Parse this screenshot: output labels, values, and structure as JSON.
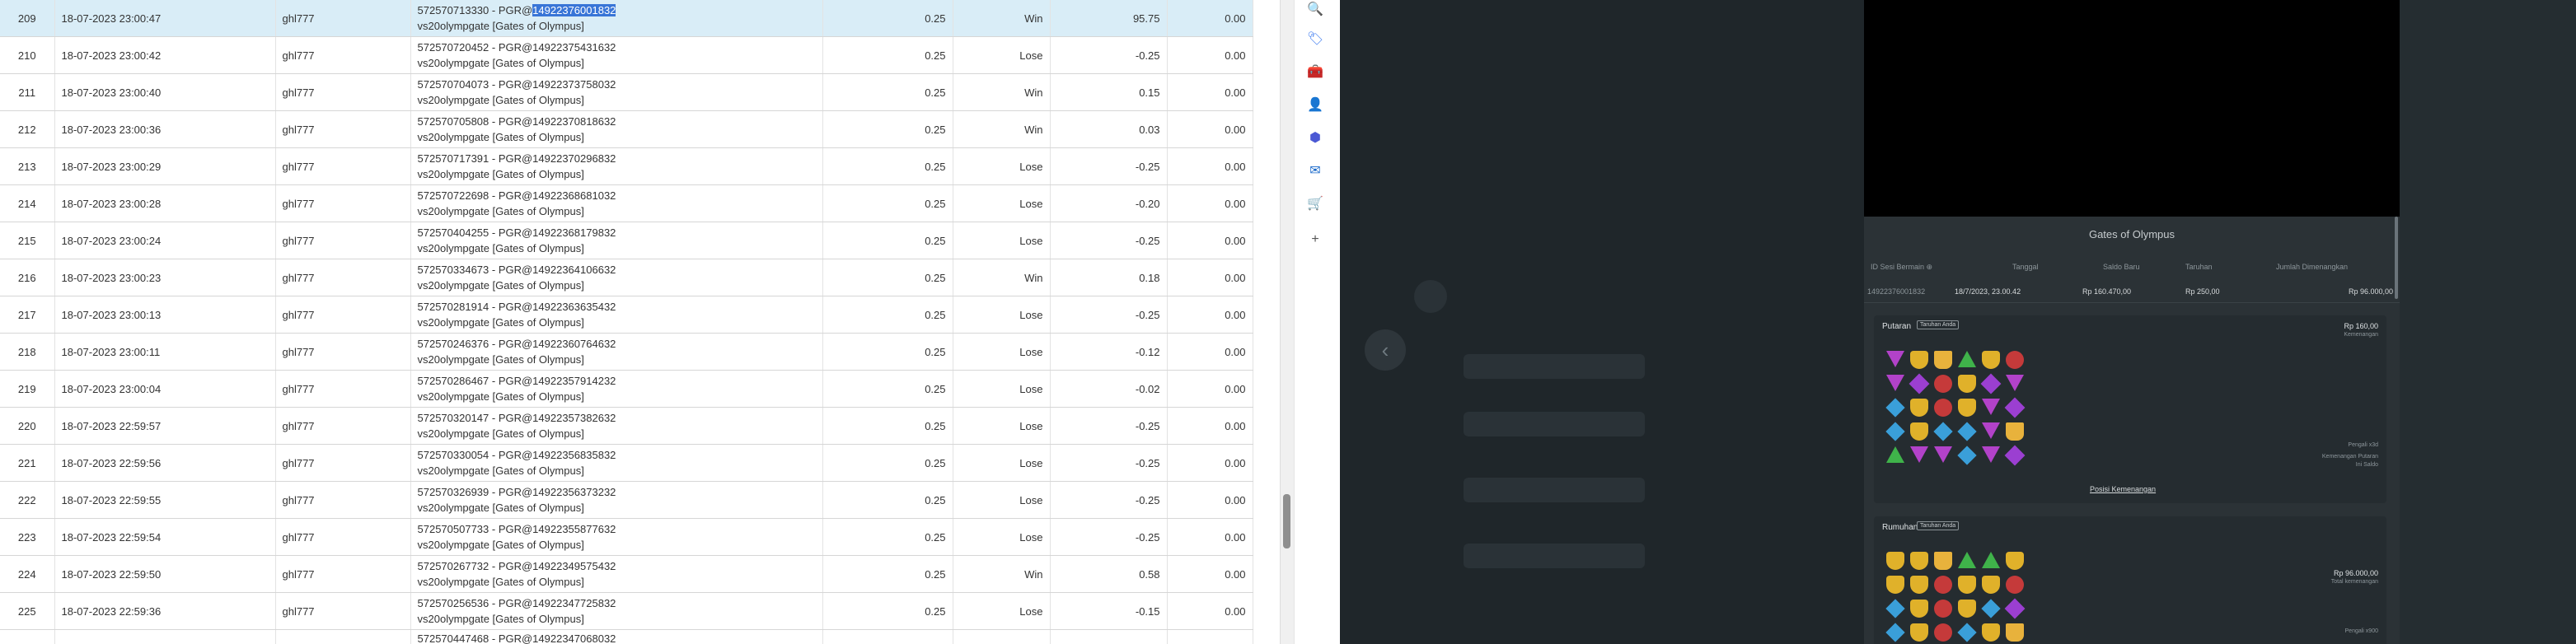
{
  "table": {
    "rows": [
      {
        "no": "209",
        "date": "18-07-2023 23:00:47",
        "user": "ghl777",
        "game_id": "572570713330 - PGR@",
        "game_id_hl": "14922376001832",
        "game_name": "vs20olympgate [Gates of Olympus]",
        "amount": "0.25",
        "result": "Win",
        "winloss": "95.75",
        "balance": "0.00",
        "selected": true
      },
      {
        "no": "210",
        "date": "18-07-2023 23:00:42",
        "user": "ghl777",
        "game_id": "572570720452 - PGR@14922375431632",
        "game_id_hl": "",
        "game_name": "vs20olympgate [Gates of Olympus]",
        "amount": "0.25",
        "result": "Lose",
        "winloss": "-0.25",
        "balance": "0.00"
      },
      {
        "no": "211",
        "date": "18-07-2023 23:00:40",
        "user": "ghl777",
        "game_id": "572570704073 - PGR@14922373758032",
        "game_id_hl": "",
        "game_name": "vs20olympgate [Gates of Olympus]",
        "amount": "0.25",
        "result": "Win",
        "winloss": "0.15",
        "balance": "0.00"
      },
      {
        "no": "212",
        "date": "18-07-2023 23:00:36",
        "user": "ghl777",
        "game_id": "572570705808 - PGR@14922370818632",
        "game_id_hl": "",
        "game_name": "vs20olympgate [Gates of Olympus]",
        "amount": "0.25",
        "result": "Win",
        "winloss": "0.03",
        "balance": "0.00"
      },
      {
        "no": "213",
        "date": "18-07-2023 23:00:29",
        "user": "ghl777",
        "game_id": "572570717391 - PGR@14922370296832",
        "game_id_hl": "",
        "game_name": "vs20olympgate [Gates of Olympus]",
        "amount": "0.25",
        "result": "Lose",
        "winloss": "-0.25",
        "balance": "0.00"
      },
      {
        "no": "214",
        "date": "18-07-2023 23:00:28",
        "user": "ghl777",
        "game_id": "572570722698 - PGR@14922368681032",
        "game_id_hl": "",
        "game_name": "vs20olympgate [Gates of Olympus]",
        "amount": "0.25",
        "result": "Lose",
        "winloss": "-0.20",
        "balance": "0.00"
      },
      {
        "no": "215",
        "date": "18-07-2023 23:00:24",
        "user": "ghl777",
        "game_id": "572570404255 - PGR@14922368179832",
        "game_id_hl": "",
        "game_name": "vs20olympgate [Gates of Olympus]",
        "amount": "0.25",
        "result": "Lose",
        "winloss": "-0.25",
        "balance": "0.00"
      },
      {
        "no": "216",
        "date": "18-07-2023 23:00:23",
        "user": "ghl777",
        "game_id": "572570334673 - PGR@14922364106632",
        "game_id_hl": "",
        "game_name": "vs20olympgate [Gates of Olympus]",
        "amount": "0.25",
        "result": "Win",
        "winloss": "0.18",
        "balance": "0.00"
      },
      {
        "no": "217",
        "date": "18-07-2023 23:00:13",
        "user": "ghl777",
        "game_id": "572570281914 - PGR@14922363635432",
        "game_id_hl": "",
        "game_name": "vs20olympgate [Gates of Olympus]",
        "amount": "0.25",
        "result": "Lose",
        "winloss": "-0.25",
        "balance": "0.00"
      },
      {
        "no": "218",
        "date": "18-07-2023 23:00:11",
        "user": "ghl777",
        "game_id": "572570246376 - PGR@14922360764632",
        "game_id_hl": "",
        "game_name": "vs20olympgate [Gates of Olympus]",
        "amount": "0.25",
        "result": "Lose",
        "winloss": "-0.12",
        "balance": "0.00"
      },
      {
        "no": "219",
        "date": "18-07-2023 23:00:04",
        "user": "ghl777",
        "game_id": "572570286467 - PGR@14922357914232",
        "game_id_hl": "",
        "game_name": "vs20olympgate [Gates of Olympus]",
        "amount": "0.25",
        "result": "Lose",
        "winloss": "-0.02",
        "balance": "0.00"
      },
      {
        "no": "220",
        "date": "18-07-2023 22:59:57",
        "user": "ghl777",
        "game_id": "572570320147 - PGR@14922357382632",
        "game_id_hl": "",
        "game_name": "vs20olympgate [Gates of Olympus]",
        "amount": "0.25",
        "result": "Lose",
        "winloss": "-0.25",
        "balance": "0.00"
      },
      {
        "no": "221",
        "date": "18-07-2023 22:59:56",
        "user": "ghl777",
        "game_id": "572570330054 - PGR@14922356835832",
        "game_id_hl": "",
        "game_name": "vs20olympgate [Gates of Olympus]",
        "amount": "0.25",
        "result": "Lose",
        "winloss": "-0.25",
        "balance": "0.00"
      },
      {
        "no": "222",
        "date": "18-07-2023 22:59:55",
        "user": "ghl777",
        "game_id": "572570326939 - PGR@14922356373232",
        "game_id_hl": "",
        "game_name": "vs20olympgate [Gates of Olympus]",
        "amount": "0.25",
        "result": "Lose",
        "winloss": "-0.25",
        "balance": "0.00"
      },
      {
        "no": "223",
        "date": "18-07-2023 22:59:54",
        "user": "ghl777",
        "game_id": "572570507733 - PGR@14922355877632",
        "game_id_hl": "",
        "game_name": "vs20olympgate [Gates of Olympus]",
        "amount": "0.25",
        "result": "Lose",
        "winloss": "-0.25",
        "balance": "0.00"
      },
      {
        "no": "224",
        "date": "18-07-2023 22:59:50",
        "user": "ghl777",
        "game_id": "572570267732 - PGR@14922349575432",
        "game_id_hl": "",
        "game_name": "vs20olympgate [Gates of Olympus]",
        "amount": "0.25",
        "result": "Win",
        "winloss": "0.58",
        "balance": "0.00"
      },
      {
        "no": "225",
        "date": "18-07-2023 22:59:36",
        "user": "ghl777",
        "game_id": "572570256536 - PGR@14922347725832",
        "game_id_hl": "",
        "game_name": "vs20olympgate [Gates of Olympus]",
        "amount": "0.25",
        "result": "Lose",
        "winloss": "-0.15",
        "balance": "0.00"
      },
      {
        "no": "",
        "date": "",
        "user": "",
        "game_id": "572570447468 - PGR@14922347068032",
        "game_id_hl": "",
        "game_name": "",
        "amount": "",
        "result": "",
        "winloss": "",
        "balance": "",
        "partial": true
      }
    ]
  },
  "extensions": [
    {
      "icon": "search-icon",
      "glyph": "🔍",
      "color": "#4a6fd8"
    },
    {
      "icon": "tag-icon",
      "glyph": "🏷",
      "color": "#3f7cf0"
    },
    {
      "icon": "toolbox-icon",
      "glyph": "🧰",
      "color": "#d9452b"
    },
    {
      "icon": "person-icon",
      "glyph": "👤",
      "color": "#7b4fc9"
    },
    {
      "icon": "settings-hex-icon",
      "glyph": "⬢",
      "color": "#4b59d4"
    },
    {
      "icon": "outlook-icon",
      "glyph": "✉",
      "color": "#1667c9"
    },
    {
      "icon": "cart-icon",
      "glyph": "🛒",
      "color": "#2a92d8"
    },
    {
      "icon": "plus-icon",
      "glyph": "+",
      "color": "#555555"
    }
  ],
  "detail": {
    "title": "Gates of Olympus",
    "headers": [
      "ID Sesi Bermain ⊕",
      "Tanggal",
      "Saldo Baru",
      "Taruhan",
      "Jumlah Dimenangkan"
    ],
    "row": {
      "session": "14922376001832",
      "date": "18/7/2023, 23.00.42",
      "balance": "Rp 160.470,00",
      "bet": "Rp 250,00",
      "won": "Rp 96.000,00"
    },
    "round1": {
      "title": "Putaran",
      "badge": "Taruhan Anda",
      "amount": "Rp 160,00",
      "amount_label": "Kemenangan",
      "link": "Posisi Kemenangan",
      "note1": "Pengali x3d",
      "note2": "Kemenangan Putaran",
      "note3": "Ini Saldo"
    },
    "round2": {
      "title": "Rumuhan",
      "badge": "Taruhan Anda",
      "amount": "Rp 96.000,00",
      "amount_label": "Total kemenangan",
      "note1": "Pengali x900"
    },
    "grid1": [
      [
        "s-gem-t",
        "s-crown",
        "s-cup",
        "s-gem-g",
        "s-crown",
        "s-heart"
      ],
      [
        "s-gem-t",
        "s-gem-p",
        "s-heart",
        "s-crown",
        "s-gem-p",
        "s-gem-t"
      ],
      [
        "s-gem-b",
        "s-crown",
        "s-heart",
        "s-crown",
        "s-gem-t",
        "s-gem-p"
      ],
      [
        "s-gem-b",
        "s-crown",
        "s-gem-b",
        "s-gem-b",
        "s-gem-t",
        "s-cup"
      ],
      [
        "s-gem-g",
        "s-gem-t",
        "s-gem-t",
        "s-gem-b",
        "s-gem-t",
        "s-gem-p"
      ]
    ],
    "grid2": [
      [
        "s-crown",
        "s-crown",
        "s-cup",
        "s-gem-g",
        "s-gem-g",
        "s-crown"
      ],
      [
        "s-crown",
        "s-crown",
        "s-heart",
        "s-crown",
        "s-crown",
        "s-heart"
      ],
      [
        "s-gem-b",
        "s-crown",
        "s-heart",
        "s-crown",
        "s-gem-b",
        "s-gem-p"
      ],
      [
        "s-gem-b",
        "s-crown",
        "s-heart",
        "s-gem-b",
        "s-crown",
        "s-cup"
      ]
    ]
  }
}
